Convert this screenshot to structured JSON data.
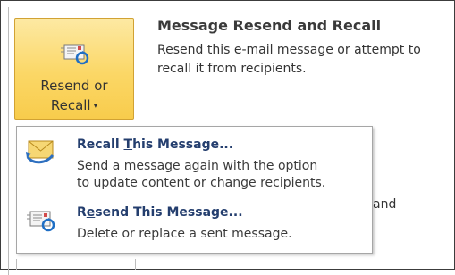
{
  "ribbon_button": {
    "label_line1": "Resend or",
    "label_line2": "Recall",
    "caret": "▾",
    "icon": "resend-envelope-icon"
  },
  "tooltip": {
    "title": "Message Resend and Recall",
    "description": "Resend this e-mail message or attempt to recall it from recipients.",
    "obscured_fragment": "and"
  },
  "menu": {
    "items": [
      {
        "title_before": "Recall ",
        "title_access_key": "T",
        "title_after": "his Message...",
        "description": "Send a message again with the option\nto update content or change recipients.",
        "icon": "recall-envelope-icon"
      },
      {
        "title_before": "R",
        "title_access_key": "e",
        "title_after": "send This Message...",
        "description": "Delete or replace a sent message.",
        "icon": "resend-envelope-icon"
      }
    ]
  },
  "colors": {
    "button_highlight": "#fbd766",
    "menu_title": "#243e6e",
    "refresh_arrow": "#1f6fc5"
  }
}
